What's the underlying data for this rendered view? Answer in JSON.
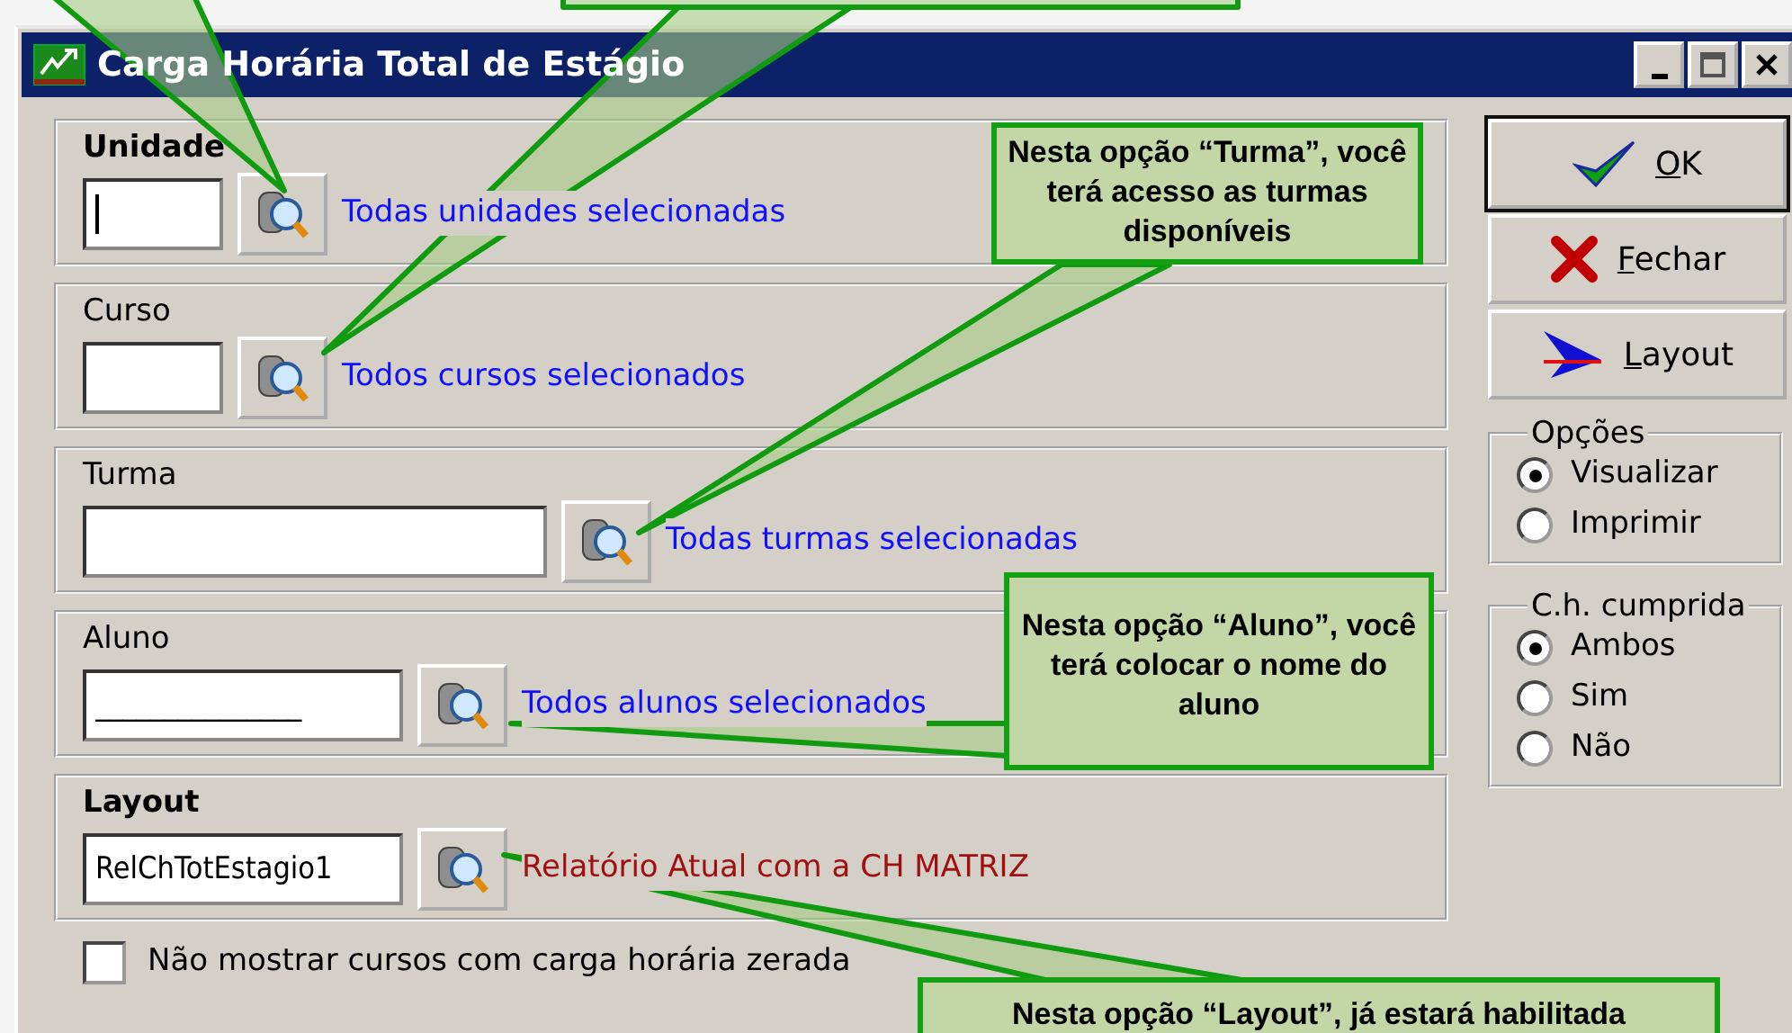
{
  "window": {
    "title": "Carga Horária Total de Estágio"
  },
  "filters": [
    {
      "label": "Unidade",
      "bold": true,
      "kind": "short",
      "focused": true,
      "status": "Todas unidades selecionadas",
      "color": "#1010ff"
    },
    {
      "label": "Curso",
      "bold": false,
      "kind": "short",
      "focused": false,
      "status": "Todos cursos selecionados",
      "color": "#1010ff"
    },
    {
      "label": "Turma",
      "bold": false,
      "kind": "wide",
      "focused": false,
      "status": "Todas turmas selecionadas",
      "color": "#1010ff"
    },
    {
      "label": "Aluno",
      "bold": false,
      "kind": "medium",
      "value": "_______________",
      "focused": false,
      "status": "Todos alunos selecionados",
      "color": "#1010ff"
    },
    {
      "label": "Layout",
      "bold": true,
      "kind": "medium",
      "value": "RelChTotEstagio1",
      "focused": false,
      "status": "Relatório Atual com a CH MATRIZ",
      "color": "#a01010"
    }
  ],
  "checkbox": {
    "label": "Não mostrar cursos com carga horária zerada",
    "checked": false
  },
  "buttons": [
    {
      "label": "OK",
      "kind": "ok",
      "default": true
    },
    {
      "label": "Fechar",
      "kind": "close",
      "default": false
    },
    {
      "label": "Layout",
      "kind": "layout",
      "default": false
    }
  ],
  "groups": [
    {
      "title": "Opções",
      "options": [
        {
          "label": "Visualizar",
          "selected": true
        },
        {
          "label": "Imprimir",
          "selected": false
        }
      ]
    },
    {
      "title": "C.h. cumprida",
      "options": [
        {
          "label": "Ambos",
          "selected": true
        },
        {
          "label": "Sim",
          "selected": false
        },
        {
          "label": "Não",
          "selected": false
        }
      ]
    }
  ],
  "callouts": [
    {
      "text": "Nesta opção “Turma”, você terá acesso as turmas disponíveis"
    },
    {
      "text": "Nesta opção “Aluno”, você terá colocar o nome do aluno"
    },
    {
      "text": "Nesta opção “Layout”, já estará habilitada"
    }
  ]
}
